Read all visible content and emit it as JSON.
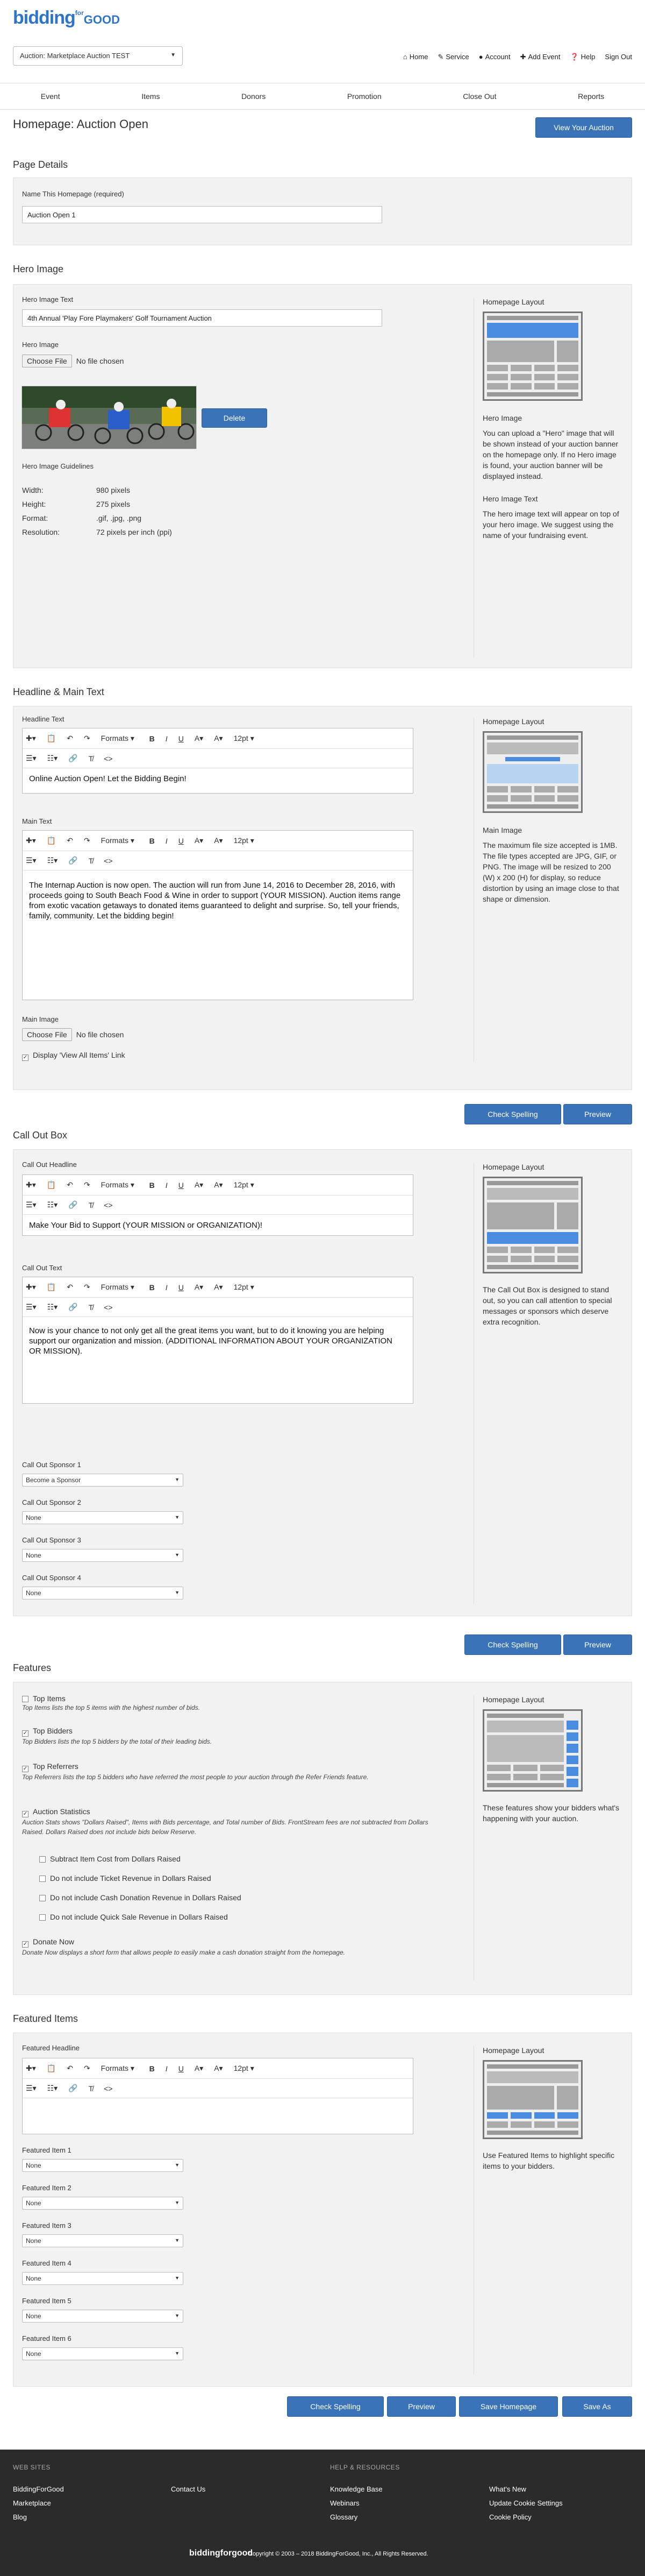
{
  "brand": {
    "logo_main": "bidding",
    "logo_sup": "for",
    "logo_good": "GOOD",
    "colors": {
      "accent": "#3a73b8",
      "footer": "#2b2b2b"
    }
  },
  "auction_select": {
    "value": "Auction: Marketplace Auction TEST"
  },
  "topnav": [
    {
      "icon": "home-icon",
      "label": "Home"
    },
    {
      "icon": "wrench-icon",
      "label": "Service"
    },
    {
      "icon": "user-icon",
      "label": "Account"
    },
    {
      "icon": "plus-icon",
      "label": "Add Event"
    },
    {
      "icon": "help-icon",
      "label": "Help"
    },
    {
      "icon": "",
      "label": "Sign Out"
    }
  ],
  "mainnav": [
    "Event",
    "Items",
    "Donors",
    "Promotion",
    "Close Out",
    "Reports"
  ],
  "page_title": "Homepage: Auction Open",
  "view_auction_btn": "View Your Auction",
  "page_details": {
    "title": "Page Details",
    "name_label": "Name This Homepage (required)",
    "name_value": "Auction Open 1"
  },
  "hero": {
    "title": "Hero Image",
    "text_label": "Hero Image Text",
    "text_value": "4th Annual 'Play Fore Playmakers' Golf Tournament Auction",
    "image_label": "Hero Image",
    "choose_file": "Choose File",
    "no_file": "No file chosen",
    "delete_btn": "Delete",
    "guidelines_title": "Hero Image Guidelines",
    "guidelines": [
      {
        "k": "Width:",
        "v": "980 pixels"
      },
      {
        "k": "Height:",
        "v": "275 pixels"
      },
      {
        "k": "Format:",
        "v": ".gif, .jpg, .png"
      },
      {
        "k": "Resolution:",
        "v": "72 pixels per inch (ppi)"
      }
    ],
    "side_title": "Homepage Layout",
    "side_h1": "Hero Image",
    "side_p1": "You can upload a \"Hero\" image that will be shown instead of your auction banner on the homepage only. If no Hero image is found, your auction banner will be displayed instead.",
    "side_h2": "Hero Image Text",
    "side_p2": "The hero image text will appear on top of your hero image. We suggest using the name of your fundraising event."
  },
  "editor_toolbar": {
    "formats": "Formats",
    "size": "12pt"
  },
  "headline_main": {
    "title": "Headline & Main Text",
    "headline_label": "Headline Text",
    "headline_value": "Online Auction Open! Let the Bidding Begin!",
    "main_label": "Main Text",
    "main_value": "The Internap Auction is now open. The auction will run from June 14, 2016 to December 28, 2016, with proceeds going to South Beach Food & Wine in order to support (YOUR MISSION). Auction items range from exotic vacation getaways to donated items guaranteed to delight and surprise. So, tell your friends, family, community. Let the bidding begin!",
    "main_image_label": "Main Image",
    "choose_file": "Choose File",
    "no_file": "No file chosen",
    "view_all_label": "Display 'View All Items' Link",
    "side_title": "Homepage Layout",
    "side_h1": "Main Image",
    "side_p1": "The maximum file size accepted is 1MB. The file types accepted are JPG, GIF, or PNG. The image will be resized to 200 (W) x 200 (H) for display, so reduce distortion by using an image close to that shape or dimension."
  },
  "buttons": {
    "check_spelling": "Check Spelling",
    "preview": "Preview",
    "save_homepage": "Save Homepage",
    "save_as": "Save As"
  },
  "callout": {
    "title": "Call Out Box",
    "headline_label": "Call Out Headline",
    "headline_value": "Make Your Bid to Support (YOUR MISSION or ORGANIZATION)!",
    "text_label": "Call Out Text",
    "text_value": "Now is your chance to not only get all the great items you want, but to do it knowing you are helping support our organization and mission. (ADDITIONAL INFORMATION ABOUT YOUR ORGANIZATION OR MISSION).",
    "sponsors": [
      {
        "label": "Call Out Sponsor 1",
        "value": "Become a Sponsor"
      },
      {
        "label": "Call Out Sponsor 2",
        "value": "None"
      },
      {
        "label": "Call Out Sponsor 3",
        "value": "None"
      },
      {
        "label": "Call Out Sponsor 4",
        "value": "None"
      }
    ],
    "side_title": "Homepage Layout",
    "side_p1": "The Call Out Box is designed to stand out, so you can call attention to special messages or sponsors which deserve extra recognition."
  },
  "features": {
    "title": "Features",
    "items": [
      {
        "label": "Top Items",
        "checked": false,
        "desc": "Top Items lists the top 5 items with the highest number of bids."
      },
      {
        "label": "Top Bidders",
        "checked": true,
        "desc": "Top Bidders lists the top 5 bidders by the total of their leading bids."
      },
      {
        "label": "Top Referrers",
        "checked": true,
        "desc": "Top Referrers lists the top 5 bidders who have referred the most people to your auction through the Refer Friends feature."
      },
      {
        "label": "Auction Statistics",
        "checked": true,
        "desc": "Auction Stats shows \"Dollars Raised\", Items with Bids percentage, and Total number of Bids. FrontStream fees are not subtracted from Dollars Raised. Dollars Raised does not include bids below Reserve."
      }
    ],
    "sub_items": [
      "Subtract Item Cost from Dollars Raised",
      "Do not include Ticket Revenue in Dollars Raised",
      "Do not include Cash Donation Revenue in Dollars Raised",
      "Do not include Quick Sale Revenue in Dollars Raised"
    ],
    "donate": {
      "label": "Donate Now",
      "checked": true,
      "desc": "Donate Now displays a short form that allows people to easily make a cash donation straight from the homepage."
    },
    "side_title": "Homepage Layout",
    "side_p1": "These features show your bidders what's happening with your auction."
  },
  "featured": {
    "title": "Featured Items",
    "headline_label": "Featured Headline",
    "items": [
      {
        "label": "Featured Item 1",
        "value": "None"
      },
      {
        "label": "Featured Item 2",
        "value": "None"
      },
      {
        "label": "Featured Item 3",
        "value": "None"
      },
      {
        "label": "Featured Item 4",
        "value": "None"
      },
      {
        "label": "Featured Item 5",
        "value": "None"
      },
      {
        "label": "Featured Item 6",
        "value": "None"
      }
    ],
    "side_title": "Homepage Layout",
    "side_p1": "Use Featured Items to highlight specific items to your bidders."
  },
  "footer": {
    "web_sites": "WEB SITES",
    "help_resources": "HELP & RESOURCES",
    "col1": [
      "BiddingForGood",
      "Marketplace",
      "Blog"
    ],
    "col2": [
      "Contact Us"
    ],
    "col3": [
      "Knowledge Base",
      "Webinars",
      "Glossary"
    ],
    "col4": [
      "What's New",
      "Update Cookie Settings",
      "Cookie Policy"
    ],
    "logo": "biddingforgood",
    "copyright": "Copyright © 2003 – 2018 BiddingForGood, Inc., All Rights Reserved."
  }
}
